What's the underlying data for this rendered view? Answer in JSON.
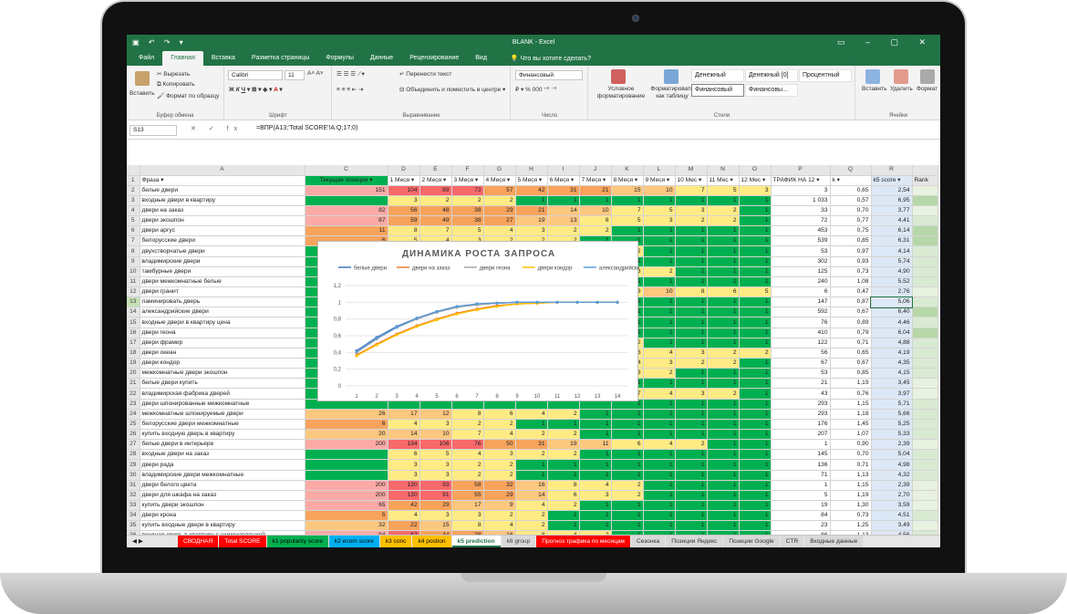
{
  "window": {
    "title": "BLANK - Excel"
  },
  "ribbon": {
    "tabs": [
      "Файл",
      "Главная",
      "Вставка",
      "Разметка страницы",
      "Формулы",
      "Данные",
      "Рецензирование",
      "Вид"
    ],
    "tell_me": "Что вы хотите сделать?",
    "paste": "Вставить",
    "cut": "Вырезать",
    "copy": "Копировать",
    "format_painter": "Формат по образцу",
    "font": "Calibri",
    "font_size": "11",
    "wrap": "Перенести текст",
    "merge": "Объединить и поместить в центре",
    "number_format": "Финансовый",
    "conditional": "Условное форматирование",
    "as_table": "Форматировать как таблицу",
    "styles": [
      "Денежный",
      "Денежный [0]",
      "Процентный",
      "Финансовый",
      "Финансовы..."
    ],
    "insert": "Вставить",
    "delete": "Удалить",
    "format": "Формат",
    "groups": {
      "clipboard": "Буфер обмена",
      "font": "Шрифт",
      "alignment": "Выравнивание",
      "number": "Число",
      "styles": "Стили",
      "cells": "Ячейки"
    }
  },
  "formula_bar": {
    "name_box": "S13",
    "formula": "=ВПР(A13;'Total SCORE'!A:Q;17;0)"
  },
  "colors": {
    "green": "#00b050",
    "lgreen": "#92d050",
    "yellow": "#ffeb84",
    "orange": "#f8a35c",
    "red": "#f8696b",
    "pink": "#fbaaa6",
    "lorange": "#fcc77f",
    "excel": "#217346"
  },
  "columns": [
    "A",
    "C",
    "D",
    "E",
    "F",
    "G",
    "H",
    "I",
    "J",
    "K",
    "L",
    "M",
    "N",
    "O",
    "P",
    "Q",
    "R"
  ],
  "headers": [
    "Фраза",
    "Текущая позиция",
    "1 Меся",
    "2 Меся",
    "3 Меся",
    "4 Меся",
    "5 Меся",
    "6 Меся",
    "7 Меся",
    "8 Меся",
    "9 Меся",
    "10 Мес",
    "11 Мес",
    "12 Мес",
    "ТРАФИК НА 12",
    "k",
    "k5 score",
    "Rank"
  ],
  "rows": [
    {
      "n": 2,
      "p": "белые двери",
      "c": "151",
      "m": [
        "104",
        "89",
        "73",
        "57",
        "42",
        "31",
        "21",
        "15",
        "10",
        "7",
        "5",
        "3"
      ],
      "t": "3",
      "k": "0,65",
      "s": "2,54"
    },
    {
      "n": 3,
      "p": "входные двери в квартиру",
      "c": "",
      "m": [
        "3",
        "2",
        "2",
        "2",
        "1",
        "1",
        "1",
        "1",
        "1",
        "1",
        "1",
        "1"
      ],
      "t": "1 033",
      "k": "0,57",
      "s": "6,95"
    },
    {
      "n": 4,
      "p": "двери на заказ",
      "c": "82",
      "m": [
        "56",
        "48",
        "38",
        "29",
        "21",
        "14",
        "10",
        "7",
        "5",
        "3",
        "2",
        "1"
      ],
      "t": "33",
      "k": "0,70",
      "s": "3,77"
    },
    {
      "n": 5,
      "p": "двери экошпон",
      "c": "87",
      "m": [
        "59",
        "49",
        "38",
        "27",
        "19",
        "13",
        "8",
        "5",
        "3",
        "2",
        "2",
        "1"
      ],
      "t": "72",
      "k": "0,77",
      "s": "4,41"
    },
    {
      "n": 6,
      "p": "двери аргус",
      "c": "11",
      "m": [
        "8",
        "7",
        "5",
        "4",
        "3",
        "2",
        "2",
        "1",
        "1",
        "1",
        "1",
        "1"
      ],
      "t": "453",
      "k": "0,75",
      "s": "6,14"
    },
    {
      "n": 7,
      "p": "белорусские двери",
      "c": "6",
      "m": [
        "5",
        "4",
        "3",
        "2",
        "2",
        "2",
        "1",
        "1",
        "1",
        "1",
        "1",
        "1"
      ],
      "t": "539",
      "k": "0,85",
      "s": "6,31"
    },
    {
      "n": 8,
      "p": "двухстворчатые двери",
      "c": "",
      "m": [
        "",
        "",
        "",
        "",
        "",
        "",
        "",
        "2",
        "1",
        "1",
        "1",
        "1"
      ],
      "t": "53",
      "k": "0,97",
      "s": "4,14"
    },
    {
      "n": 9,
      "p": "владимирские двери",
      "c": "",
      "m": [
        "",
        "",
        "",
        "",
        "",
        "",
        "",
        "1",
        "1",
        "1",
        "1",
        "1"
      ],
      "t": "302",
      "k": "0,93",
      "s": "5,74"
    },
    {
      "n": 10,
      "p": "тамбурные двери",
      "c": "",
      "m": [
        "",
        "",
        "",
        "",
        "",
        "",
        "",
        "3",
        "2",
        "1",
        "1",
        "1"
      ],
      "t": "125",
      "k": "0,73",
      "s": "4,90"
    },
    {
      "n": 11,
      "p": "двери межкомнатные белые",
      "c": "",
      "m": [
        "",
        "",
        "",
        "",
        "",
        "",
        "",
        "1",
        "1",
        "1",
        "1",
        "1"
      ],
      "t": "240",
      "k": "1,08",
      "s": "5,52"
    },
    {
      "n": 12,
      "p": "двери гранит",
      "c": "",
      "m": [
        "",
        "",
        "",
        "",
        "",
        "",
        "",
        "3",
        "10",
        "8",
        "6",
        "5"
      ],
      "t": "6",
      "k": "0,47",
      "s": "2,76"
    },
    {
      "n": 13,
      "p": "ламинировать дверь",
      "c": "",
      "m": [
        "",
        "",
        "",
        "",
        "",
        "",
        "",
        "1",
        "1",
        "1",
        "1",
        "1"
      ],
      "t": "147",
      "k": "0,87",
      "s": "5,06"
    },
    {
      "n": 14,
      "p": "александрийские двери",
      "c": "",
      "m": [
        "",
        "",
        "",
        "",
        "",
        "",
        "",
        "1",
        "1",
        "1",
        "1",
        "1"
      ],
      "t": "592",
      "k": "0,67",
      "s": "6,40"
    },
    {
      "n": 15,
      "p": "входные двери в квартиру цена",
      "c": "",
      "m": [
        "",
        "",
        "",
        "",
        "",
        "",
        "",
        "1",
        "1",
        "1",
        "1",
        "1"
      ],
      "t": "76",
      "k": "0,89",
      "s": "4,46"
    },
    {
      "n": 16,
      "p": "двери геона",
      "c": "",
      "m": [
        "",
        "",
        "",
        "",
        "",
        "",
        "",
        "1",
        "1",
        "1",
        "1",
        "1"
      ],
      "t": "410",
      "k": "0,79",
      "s": "6,04"
    },
    {
      "n": 17,
      "p": "двери фрамир",
      "c": "",
      "m": [
        "",
        "",
        "",
        "",
        "",
        "",
        "",
        "2",
        "1",
        "1",
        "1",
        "1"
      ],
      "t": "122",
      "k": "0,71",
      "s": "4,88"
    },
    {
      "n": 18,
      "p": "двери океан",
      "c": "",
      "m": [
        "",
        "",
        "",
        "",
        "",
        "",
        "",
        "6",
        "4",
        "3",
        "2",
        "2"
      ],
      "t": "56",
      "k": "0,65",
      "s": "4,19"
    },
    {
      "n": 19,
      "p": "двери кондор",
      "c": "",
      "m": [
        "",
        "",
        "",
        "",
        "",
        "",
        "",
        "4",
        "3",
        "2",
        "2",
        "1"
      ],
      "t": "67",
      "k": "0,67",
      "s": "4,35"
    },
    {
      "n": 20,
      "p": "межкомнатные двери экошпон",
      "c": "",
      "m": [
        "",
        "",
        "",
        "",
        "",
        "",
        "",
        "3",
        "2",
        "1",
        "1",
        "1"
      ],
      "t": "53",
      "k": "0,85",
      "s": "4,15"
    },
    {
      "n": 21,
      "p": "белые двери купить",
      "c": "",
      "m": [
        "",
        "",
        "",
        "",
        "",
        "",
        "",
        "1",
        "1",
        "1",
        "1",
        "1"
      ],
      "t": "21",
      "k": "1,19",
      "s": "3,45"
    },
    {
      "n": 22,
      "p": "владимирская фабрика дверей",
      "c": "",
      "m": [
        "",
        "",
        "",
        "",
        "",
        "",
        "",
        "7",
        "4",
        "3",
        "2",
        "1"
      ],
      "t": "43",
      "k": "0,76",
      "s": "3,97"
    },
    {
      "n": 23,
      "p": "двери шпонированные межкомнатные",
      "c": "",
      "m": [
        "",
        "",
        "",
        "",
        "",
        "",
        "",
        "1",
        "1",
        "1",
        "1",
        "1"
      ],
      "t": "293",
      "k": "1,15",
      "s": "5,71"
    },
    {
      "n": 24,
      "p": "межкомнатные шпонируемые двери",
      "c": "26",
      "m": [
        "17",
        "12",
        "8",
        "6",
        "4",
        "2",
        "1",
        "1",
        "1",
        "1",
        "1",
        "1"
      ],
      "t": "293",
      "k": "1,18",
      "s": "5,66"
    },
    {
      "n": 25,
      "p": "белорусские двери межкомнатные",
      "c": "6",
      "m": [
        "4",
        "3",
        "2",
        "2",
        "1",
        "1",
        "1",
        "1",
        "1",
        "1",
        "1",
        "1"
      ],
      "t": "176",
      "k": "1,45",
      "s": "5,25"
    },
    {
      "n": 26,
      "p": "купить входную дверь в квартиру",
      "c": "20",
      "m": [
        "14",
        "10",
        "7",
        "4",
        "2",
        "2",
        "1",
        "1",
        "1",
        "1",
        "1",
        "1"
      ],
      "t": "207",
      "k": "1,07",
      "s": "5,33"
    },
    {
      "n": 27,
      "p": "белые двери в интерьере",
      "c": "200",
      "m": [
        "134",
        "106",
        "76",
        "50",
        "31",
        "19",
        "11",
        "6",
        "4",
        "2",
        "1",
        "1"
      ],
      "t": "1",
      "k": "0,90",
      "s": "2,39"
    },
    {
      "n": 28,
      "p": "входные двери на заказ",
      "c": "",
      "m": [
        "6",
        "5",
        "4",
        "3",
        "2",
        "2",
        "1",
        "1",
        "1",
        "1",
        "1",
        "1"
      ],
      "t": "145",
      "k": "0,70",
      "s": "5,04"
    },
    {
      "n": 29,
      "p": "двери рада",
      "c": "",
      "m": [
        "3",
        "3",
        "2",
        "2",
        "1",
        "1",
        "1",
        "1",
        "1",
        "1",
        "1",
        "1"
      ],
      "t": "136",
      "k": "0,71",
      "s": "4,98"
    },
    {
      "n": 30,
      "p": "владимирские двери межкомнатные",
      "c": "",
      "m": [
        "3",
        "3",
        "2",
        "2",
        "1",
        "1",
        "1",
        "1",
        "1",
        "1",
        "1",
        "1"
      ],
      "t": "71",
      "k": "1,13",
      "s": "4,32"
    },
    {
      "n": 31,
      "p": "двери белого цвета",
      "c": "200",
      "m": [
        "130",
        "93",
        "58",
        "32",
        "16",
        "8",
        "4",
        "2",
        "1",
        "1",
        "1",
        "1"
      ],
      "t": "1",
      "k": "1,15",
      "s": "2,39"
    },
    {
      "n": 32,
      "p": "двери для шкафа на заказ",
      "c": "200",
      "m": [
        "130",
        "91",
        "55",
        "29",
        "14",
        "6",
        "3",
        "2",
        "1",
        "1",
        "1",
        "1"
      ],
      "t": "5",
      "k": "1,19",
      "s": "2,70"
    },
    {
      "n": 33,
      "p": "купить двери экошпон",
      "c": "65",
      "m": [
        "42",
        "29",
        "17",
        "9",
        "4",
        "2",
        "1",
        "1",
        "1",
        "1",
        "1",
        "1"
      ],
      "t": "19",
      "k": "1,30",
      "s": "3,59"
    },
    {
      "n": 34,
      "p": "двери крона",
      "c": "5",
      "m": [
        "4",
        "3",
        "3",
        "2",
        "2",
        "1",
        "1",
        "1",
        "1",
        "1",
        "1",
        "1"
      ],
      "t": "84",
      "k": "0,73",
      "s": "4,51"
    },
    {
      "n": 35,
      "p": "купить входные двери в квартиру",
      "c": "32",
      "m": [
        "22",
        "15",
        "8",
        "4",
        "2",
        "1",
        "1",
        "1",
        "1",
        "1",
        "1",
        "1"
      ],
      "t": "23",
      "k": "1,25",
      "s": "3,49"
    },
    {
      "n": 36,
      "p": "входная дверь в квартиру с шумоизоляцией",
      "c": "94",
      "m": [
        "62",
        "44",
        "28",
        "16",
        "8",
        "4",
        "2",
        "1",
        "1",
        "1",
        "1",
        "1"
      ],
      "t": "86",
      "k": "1,13",
      "s": "4,56"
    }
  ],
  "chart_data": {
    "type": "line",
    "title": "ДИНАМИКА РОСТА ЗАПРОСА",
    "x": [
      1,
      2,
      3,
      4,
      5,
      6,
      7,
      8,
      9,
      10,
      11,
      12,
      13,
      14
    ],
    "ylim": [
      0,
      1.2
    ],
    "yticks": [
      "0",
      "0,2",
      "0,4",
      "0,6",
      "0,8",
      "1",
      "1,2"
    ],
    "legend_position": "top",
    "series": [
      {
        "name": "белые двери",
        "color": "#4472c4",
        "values": [
          0.42,
          0.58,
          0.71,
          0.81,
          0.89,
          0.95,
          0.98,
          0.99,
          1,
          1,
          1,
          1,
          1,
          1
        ]
      },
      {
        "name": "двери на заказ",
        "color": "#ed7d31",
        "values": [
          0.37,
          0.5,
          0.62,
          0.72,
          0.8,
          0.87,
          0.92,
          0.96,
          0.98,
          0.99,
          1,
          1,
          1,
          1
        ]
      },
      {
        "name": "двери геона",
        "color": "#a5a5a5",
        "values": [
          0.4,
          0.56,
          0.7,
          0.8,
          0.88,
          0.94,
          0.97,
          0.99,
          1,
          1,
          1,
          1,
          1,
          1
        ]
      },
      {
        "name": "двери кондор",
        "color": "#ffc000",
        "values": [
          0.36,
          0.49,
          0.61,
          0.71,
          0.79,
          0.86,
          0.91,
          0.95,
          0.98,
          0.99,
          1,
          1,
          1,
          1
        ]
      },
      {
        "name": "александрийские двери",
        "color": "#5b9bd5",
        "values": [
          0.41,
          0.57,
          0.7,
          0.81,
          0.89,
          0.95,
          0.98,
          0.99,
          1,
          1,
          1,
          1,
          1,
          1
        ]
      }
    ]
  },
  "sheet_tabs": [
    {
      "label": "СВОДНАЯ",
      "bg": "#ff0000",
      "fg": "#ffffff"
    },
    {
      "label": "Total SCORE",
      "bg": "#ff0000",
      "fg": "#ffffff"
    },
    {
      "label": "k1 popularity score",
      "bg": "#00b050",
      "fg": "#000000"
    },
    {
      "label": "k2 ecom score",
      "bg": "#00b0f0",
      "fg": "#000000"
    },
    {
      "label": "k3 conc",
      "bg": "#ffc000",
      "fg": "#000000"
    },
    {
      "label": "k4 postion",
      "bg": "#ffc000",
      "fg": "#000000"
    },
    {
      "label": "k5 prediction",
      "bg": "#ffffff",
      "fg": "#217346"
    },
    {
      "label": "k6 group",
      "bg": "#d9d9d9",
      "fg": "#444444"
    },
    {
      "label": "Прогноз трафика по месяцам",
      "bg": "#ff0000",
      "fg": "#ffffff"
    },
    {
      "label": "Сезонка",
      "bg": "#d9d9d9",
      "fg": "#333333"
    },
    {
      "label": "Позиции Яндекс",
      "bg": "#d9d9d9",
      "fg": "#333333"
    },
    {
      "label": "Позиции Google",
      "bg": "#d9d9d9",
      "fg": "#333333"
    },
    {
      "label": "CTR",
      "bg": "#d9d9d9",
      "fg": "#333333"
    },
    {
      "label": "Входные данные",
      "bg": "#d9d9d9",
      "fg": "#333333"
    }
  ]
}
